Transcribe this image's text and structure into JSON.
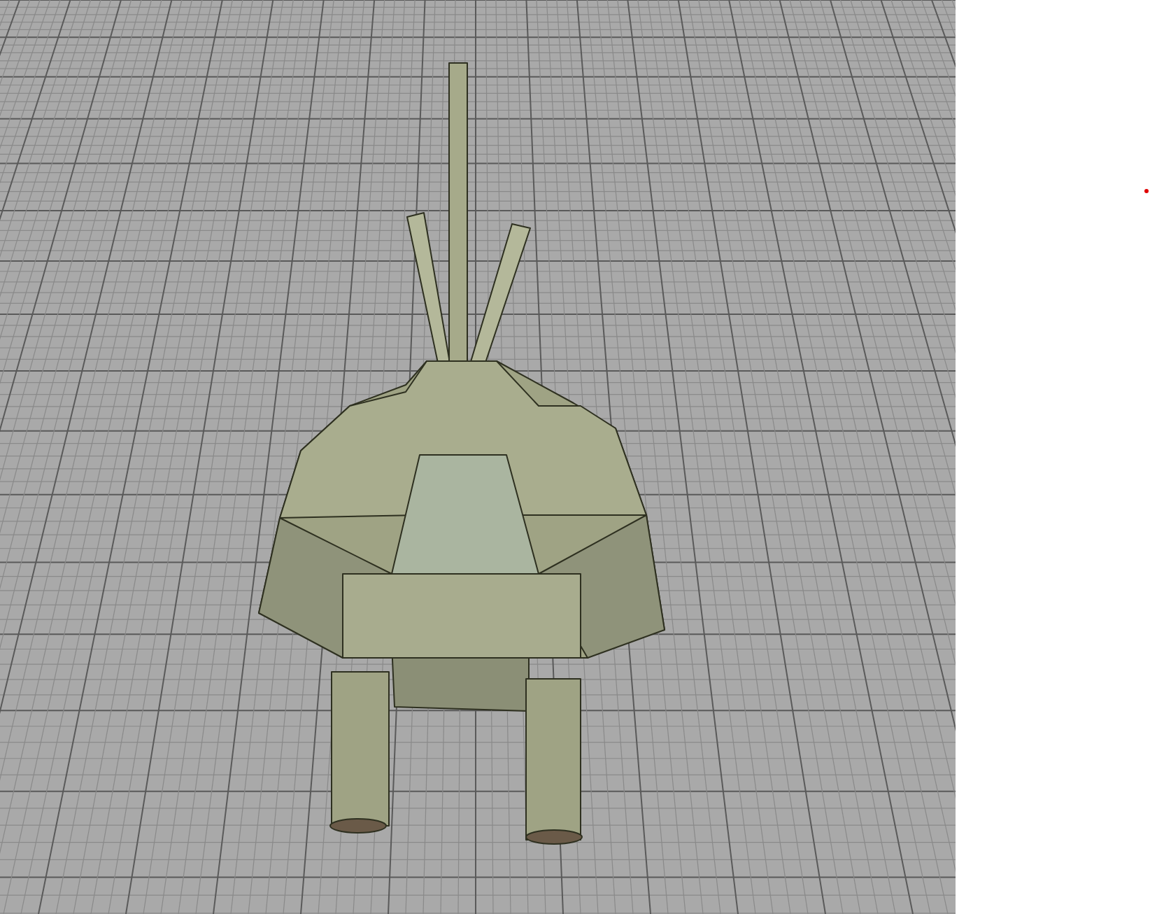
{
  "viewport": {
    "grid_visible": true,
    "model_visible": true
  },
  "side_panel": {
    "marker_visible": true
  }
}
